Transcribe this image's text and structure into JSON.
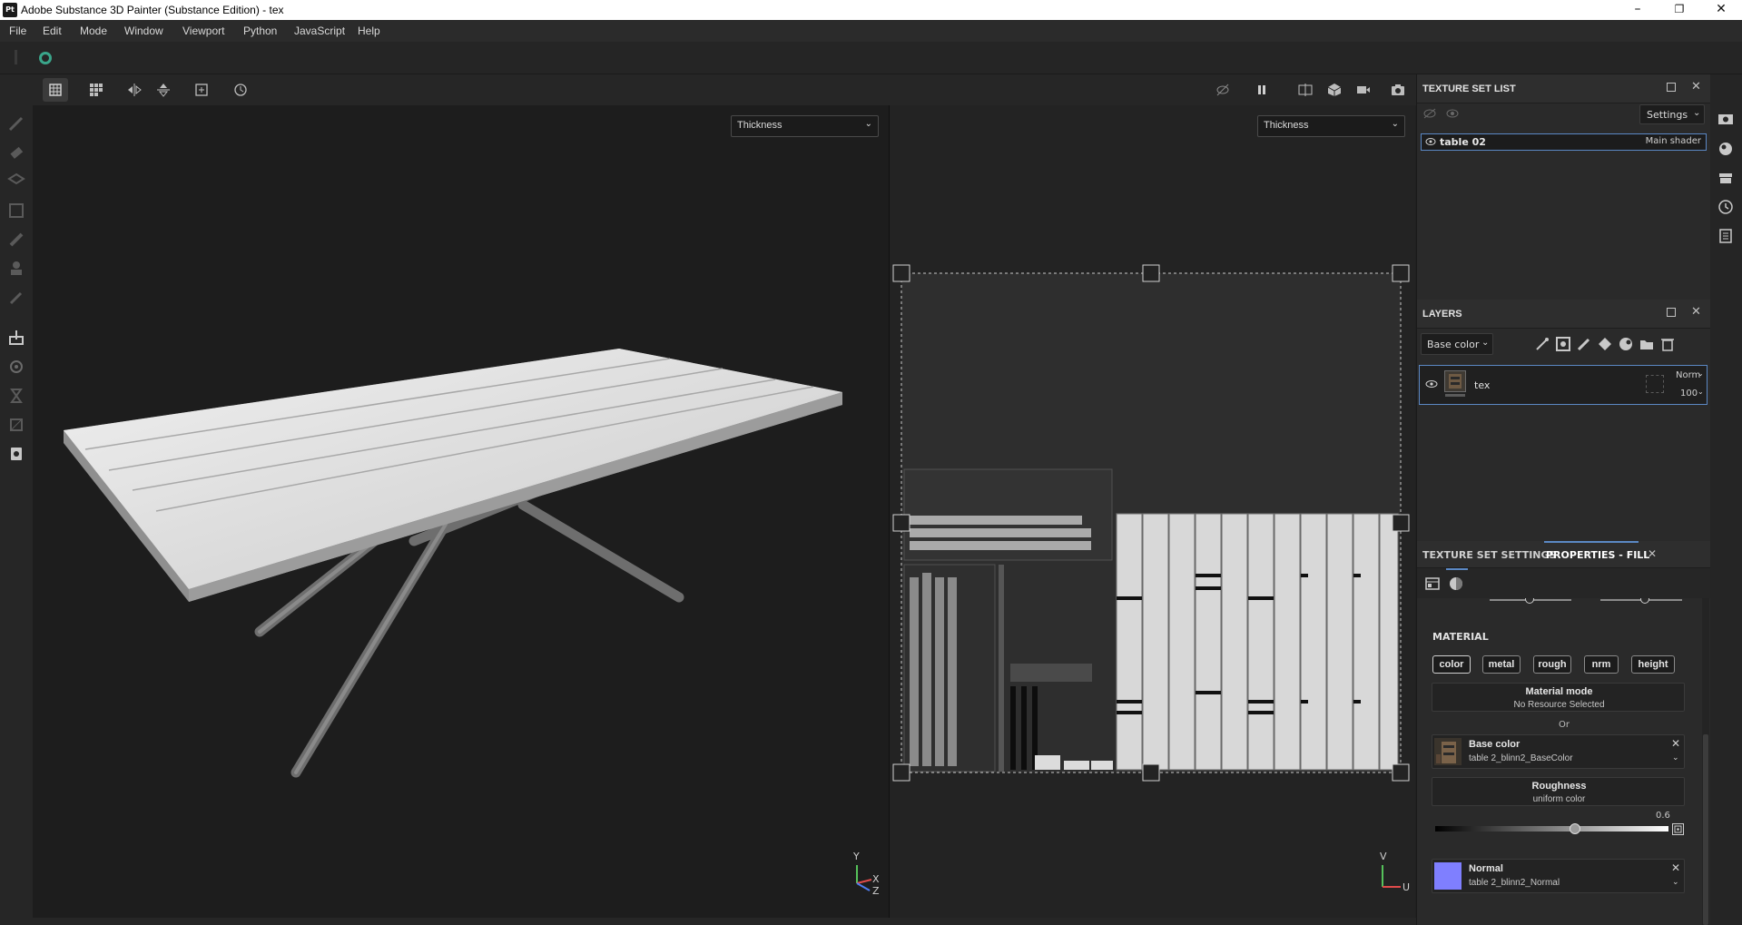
{
  "window": {
    "title": "Adobe Substance 3D Painter (Substance Edition) - tex",
    "app_icon": "Pt",
    "minimize_glyph": "–",
    "maximize_glyph": "❐",
    "close_glyph": "✕"
  },
  "menu": [
    "File",
    "Edit",
    "Mode",
    "Window",
    "Viewport",
    "Python",
    "JavaScript",
    "Help"
  ],
  "viewports": {
    "left_channel": "Thickness",
    "right_channel": "Thickness",
    "axis_3d": {
      "y": "Y",
      "x": "X",
      "z": "Z"
    },
    "axis_2d": {
      "v": "V",
      "u": "U"
    }
  },
  "texture_set_list": {
    "title": "TEXTURE SET LIST",
    "settings_label": "Settings",
    "item_name": "table 02",
    "item_shader": "Main shader"
  },
  "layers": {
    "title": "LAYERS",
    "channel": "Base color",
    "layer_name": "tex",
    "blend_mode": "Norm",
    "opacity": "100"
  },
  "properties": {
    "tab_texture_set_settings": "TEXTURE SET SETTINGS",
    "tab_properties_fill": "PROPERTIES - FILL",
    "material_heading": "MATERIAL",
    "channels": [
      "color",
      "metal",
      "rough",
      "nrm",
      "height"
    ],
    "material_mode_label": "Material mode",
    "material_mode_value": "No Resource Selected",
    "or_label": "Or",
    "base_color_label": "Base color",
    "base_color_value": "table 2_blinn2_BaseColor",
    "roughness_label": "Roughness",
    "roughness_value": "uniform color",
    "roughness_number": "0.6",
    "roughness_fraction": 0.6,
    "normal_label": "Normal",
    "normal_value": "table 2_blinn2_Normal",
    "normal_swatch": "#7f7fff"
  },
  "colors": {
    "accent_blue": "#5b88c4",
    "status_green": "#3aa58a"
  },
  "icons": {
    "toolbar": [
      "single-view-icon",
      "grid-view-icon",
      "mirror-x-icon",
      "mirror-y-icon",
      "fit-view-icon",
      "history-icon"
    ],
    "left_tools": [
      "paint-icon",
      "eraser-icon",
      "projection-icon",
      "polyfill-icon",
      "smudge-icon",
      "clone-icon",
      "picker-icon",
      "bake-icon",
      "settings-icon",
      "timer-icon",
      "geometry-icon",
      "export-icon"
    ],
    "right_strip": [
      "display-settings-icon",
      "shader-settings-icon",
      "shelf-icon",
      "history-icon",
      "log-icon"
    ]
  }
}
